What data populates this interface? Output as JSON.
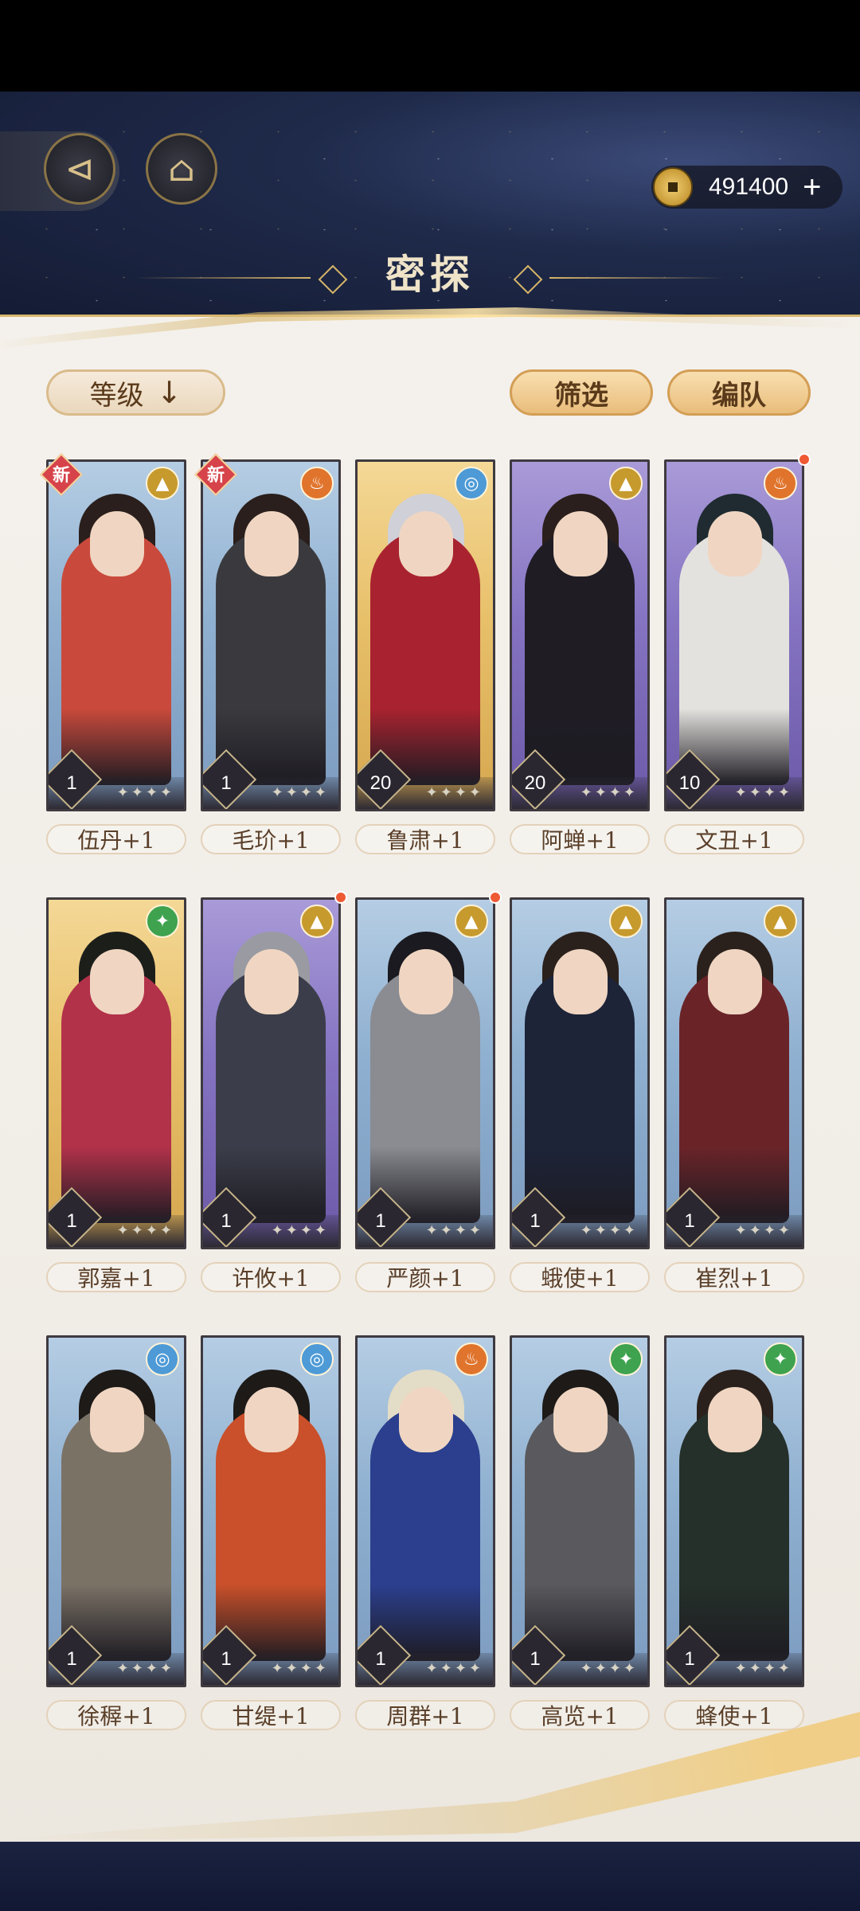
{
  "header": {
    "title": "密探",
    "currency": {
      "value": "491400",
      "icon": "coin-icon",
      "add_label": "+"
    }
  },
  "toolbar": {
    "sort_label": "等级",
    "sort_arrow": "↓",
    "order_icon": "chevron-down-icon",
    "filter_label": "筛选",
    "team_label": "编队"
  },
  "cards": [
    {
      "name": "伍丹+1",
      "level": "1",
      "element": "earth",
      "new_label": "新",
      "new": true,
      "dot": false,
      "bg": "blue",
      "hair": "#2a1f1c",
      "outfit": "#c94a3c"
    },
    {
      "name": "毛玠+1",
      "level": "1",
      "element": "fire",
      "new_label": "新",
      "new": true,
      "dot": false,
      "bg": "blue",
      "hair": "#2a1f1c",
      "outfit": "#3a3a3e"
    },
    {
      "name": "鲁肃+1",
      "level": "20",
      "element": "water",
      "new": false,
      "dot": false,
      "bg": "gold",
      "hair": "#cfd0d8",
      "outfit": "#a8232f"
    },
    {
      "name": "阿蝉+1",
      "level": "20",
      "element": "earth",
      "new": false,
      "dot": false,
      "bg": "purple",
      "hair": "#2a1f1c",
      "outfit": "#1f1c24"
    },
    {
      "name": "文丑+1",
      "level": "10",
      "element": "fire",
      "new": false,
      "dot": true,
      "bg": "purple",
      "hair": "#1f2b30",
      "outfit": "#e4e2de"
    },
    {
      "name": "郭嘉+1",
      "level": "1",
      "element": "wind",
      "new": false,
      "dot": false,
      "bg": "gold",
      "hair": "#1c1e1a",
      "outfit": "#b2324a"
    },
    {
      "name": "许攸+1",
      "level": "1",
      "element": "earth",
      "new": false,
      "dot": true,
      "bg": "purple",
      "hair": "#9a9aa2",
      "outfit": "#3b3e4a"
    },
    {
      "name": "严颜+1",
      "level": "1",
      "element": "earth",
      "new": false,
      "dot": true,
      "bg": "blue",
      "hair": "#1a1a20",
      "outfit": "#8a8c92"
    },
    {
      "name": "蛾使+1",
      "level": "1",
      "element": "earth",
      "new": false,
      "dot": false,
      "bg": "blue",
      "hair": "#2b211c",
      "outfit": "#1d2438"
    },
    {
      "name": "崔烈+1",
      "level": "1",
      "element": "earth",
      "new": false,
      "dot": false,
      "bg": "blue",
      "hair": "#2b211c",
      "outfit": "#6a2428"
    },
    {
      "name": "徐稺+1",
      "level": "1",
      "element": "water",
      "new": false,
      "dot": false,
      "bg": "blue",
      "hair": "#1d1a18",
      "outfit": "#7b7266"
    },
    {
      "name": "甘缇+1",
      "level": "1",
      "element": "water",
      "new": false,
      "dot": false,
      "bg": "blue",
      "hair": "#1d1a18",
      "outfit": "#c9502a"
    },
    {
      "name": "周群+1",
      "level": "1",
      "element": "fire",
      "new": false,
      "dot": false,
      "bg": "blue",
      "hair": "#e3dcc6",
      "outfit": "#2b3f8e"
    },
    {
      "name": "高览+1",
      "level": "1",
      "element": "wind",
      "new": false,
      "dot": false,
      "bg": "blue",
      "hair": "#1d1a18",
      "outfit": "#5a5a5e"
    },
    {
      "name": "蜂使+1",
      "level": "1",
      "element": "wind",
      "new": false,
      "dot": false,
      "bg": "blue",
      "hair": "#2b211c",
      "outfit": "#25302a"
    }
  ],
  "element_icons": {
    "earth": "▲",
    "fire": "♨",
    "water": "◎",
    "wind": "✦"
  },
  "star_glyphs": "✦✦✦✦",
  "nav": {
    "back_icon": "back-arrow-icon",
    "home_icon": "pavilion-icon"
  }
}
